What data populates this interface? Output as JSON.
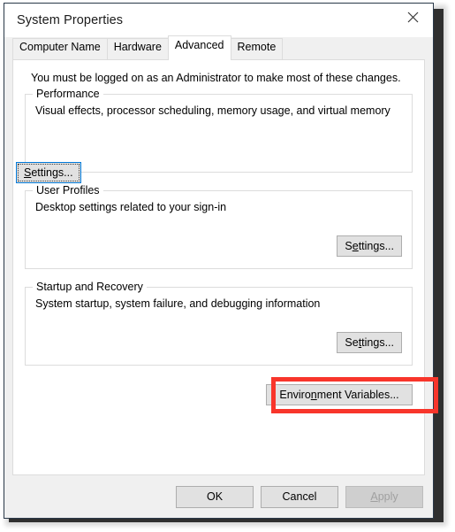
{
  "window": {
    "title": "System Properties",
    "close_icon": "close-icon"
  },
  "tabs": [
    {
      "label": "Computer Name",
      "selected": false
    },
    {
      "label": "Hardware",
      "selected": false
    },
    {
      "label": "Advanced",
      "selected": true
    },
    {
      "label": "Remote",
      "selected": false
    }
  ],
  "content": {
    "intro": "You must be logged on as an Administrator to make most of these changes.",
    "groups": [
      {
        "label": "Performance",
        "description": "Visual effects, processor scheduling, memory usage, and virtual memory",
        "button": {
          "prefix": "",
          "accel": "S",
          "suffix": "ettings...",
          "focused": true
        }
      },
      {
        "label": "User Profiles",
        "description": "Desktop settings related to your sign-in",
        "button": {
          "prefix": "S",
          "accel": "e",
          "suffix": "ttings...",
          "focused": false
        }
      },
      {
        "label": "Startup and Recovery",
        "description": "System startup, system failure, and debugging information",
        "button": {
          "prefix": "Se",
          "accel": "t",
          "suffix": "tings...",
          "focused": false
        }
      }
    ],
    "environment_variables_button": {
      "prefix": "Enviro",
      "accel": "n",
      "suffix": "ment Variables..."
    }
  },
  "annotation": {
    "color": "#f8352b",
    "target": "environment-variables-button"
  },
  "footer": {
    "ok": {
      "label": "OK",
      "disabled": false
    },
    "cancel": {
      "label": "Cancel",
      "disabled": false
    },
    "apply": {
      "prefix": "",
      "accel": "A",
      "suffix": "pply",
      "disabled": true
    }
  }
}
